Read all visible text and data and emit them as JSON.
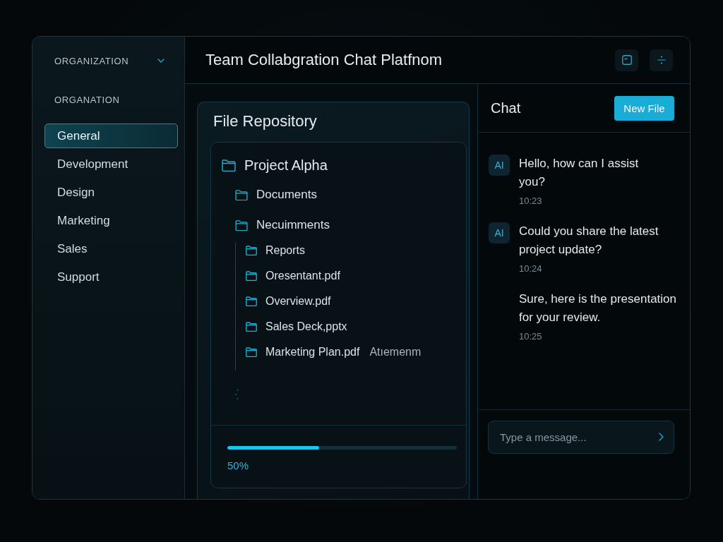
{
  "sidebar": {
    "switcher": {
      "label": "ORGANIZATION"
    },
    "section_label": "ORGANATION",
    "items": [
      {
        "label": "General",
        "selected": true
      },
      {
        "label": "Development",
        "selected": false
      },
      {
        "label": "Design",
        "selected": false
      },
      {
        "label": "Marketing",
        "selected": false
      },
      {
        "label": "Sales",
        "selected": false
      },
      {
        "label": "Support",
        "selected": false
      }
    ]
  },
  "header": {
    "title": "Team Collabgration Chat Platfnom"
  },
  "file_repository": {
    "title": "File Repository",
    "tree": [
      {
        "label": "Project Alpha",
        "children": [
          {
            "label": "Documents"
          },
          {
            "label": "Necuimments",
            "children": [
              {
                "label": "Reports"
              },
              {
                "label": "Oresentant.pdf"
              },
              {
                "label": "Overview.pdf"
              },
              {
                "label": "Sales Deck,pptx"
              },
              {
                "label": "Marketing Plan.pdf",
                "tag": "Atıemenm"
              }
            ]
          }
        ]
      }
    ],
    "progress": {
      "level": 0.4,
      "label": "50%"
    }
  },
  "chat": {
    "title": "Chat",
    "new_file_button": "New File",
    "messages": [
      {
        "kind": "incoming",
        "avatar": "AI",
        "text": "Hello, how can I assist you?",
        "time": "10:23"
      },
      {
        "kind": "incoming",
        "avatar": "AI",
        "text": "Could you share the latest project update?",
        "time": "10:24"
      },
      {
        "kind": "outgoing",
        "text": "Sure, here is the presentation for your review.",
        "time": "10:25"
      }
    ],
    "input": {
      "placeholder": "Type a message..."
    }
  }
}
